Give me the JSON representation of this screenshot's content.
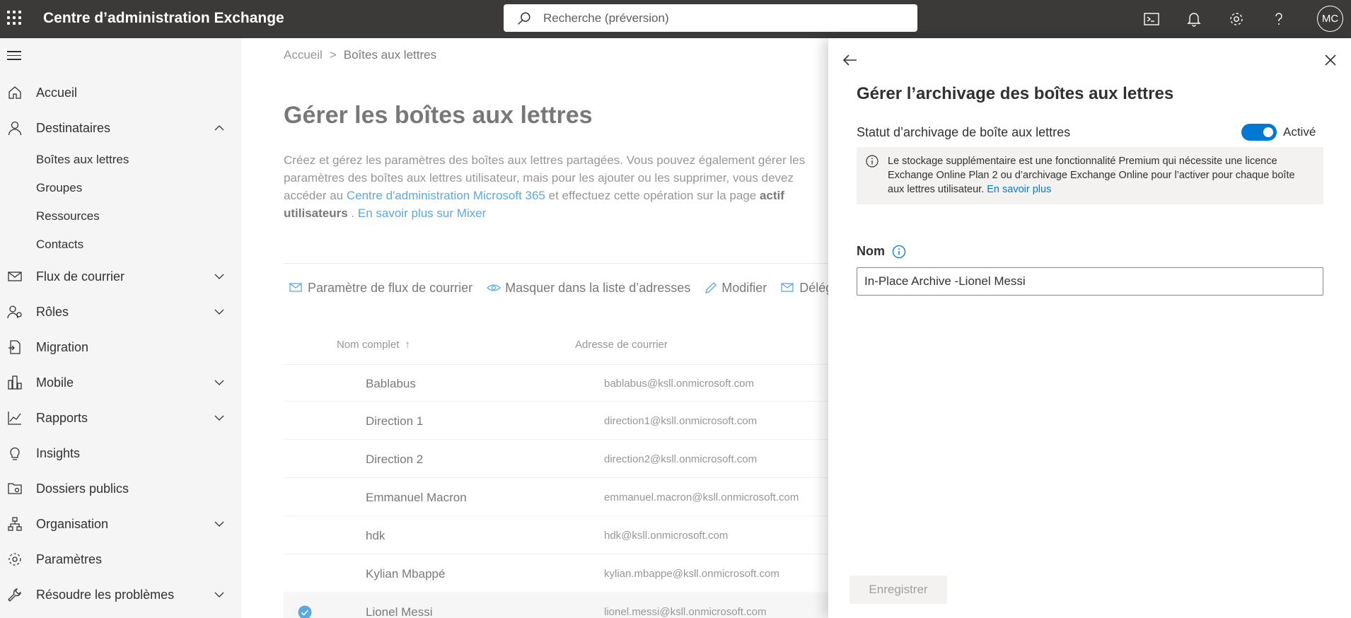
{
  "header": {
    "app_title": "Centre d’administration Exchange",
    "search_placeholder": "Recherche (préversion)",
    "icons": [
      "terminal-icon",
      "bell-icon",
      "gear-icon",
      "help-icon"
    ],
    "avatar_initials": "MC"
  },
  "sidebar": {
    "items": [
      {
        "label": "Accueil",
        "icon": "home-icon"
      },
      {
        "label": "Destinataires",
        "icon": "person-icon",
        "expanded": true
      },
      {
        "label": "Flux de courrier",
        "icon": "mail-icon"
      },
      {
        "label": "Rôles",
        "icon": "roles-icon"
      },
      {
        "label": "Migration",
        "icon": "migration-icon"
      },
      {
        "label": "Mobile",
        "icon": "mobile-icon"
      },
      {
        "label": "Rapports",
        "icon": "chart-icon"
      },
      {
        "label": "Insights",
        "icon": "lightbulb-icon"
      },
      {
        "label": "Dossiers publics",
        "icon": "folder-icon"
      },
      {
        "label": "Organisation",
        "icon": "org-icon"
      },
      {
        "label": "Paramètres",
        "icon": "gear-icon"
      },
      {
        "label": "Résoudre les problèmes",
        "icon": "wrench-icon"
      }
    ],
    "subitems": [
      "Boîtes aux lettres",
      "Groupes",
      "Ressources",
      "Contacts"
    ]
  },
  "main": {
    "breadcrumb": [
      "Accueil",
      "Boîtes aux lettres"
    ],
    "title": "Gérer les boîtes aux lettres",
    "desc_1": "Créez et gérez les paramètres des boîtes aux lettres partagées. Vous pouvez également gérer les paramètres des boîtes aux lettres utilisateur, mais pour les ajouter ou les supprimer, vous devez accéder au ",
    "desc_link_1": "Centre d'administration Microsoft 365",
    "desc_2": " et effectuez cette opération sur la page ",
    "desc_bold": "actif utilisateurs",
    "desc_3": " . ",
    "desc_link_2": "En savoir plus sur Mixer",
    "toolbar": [
      "Paramètre de flux de courrier",
      "Masquer dans la liste d’adresses",
      "Modifier",
      "Délég"
    ],
    "columns": {
      "name": "Nom complet",
      "sort_arrow": "↑",
      "email": "Adresse de courrier"
    },
    "rows": [
      {
        "name": "Bablabus",
        "email": "bablabus@ksll.onmicrosoft.com"
      },
      {
        "name": "Direction 1",
        "email": "direction1@ksll.onmicrosoft.com"
      },
      {
        "name": "Direction 2",
        "email": "direction2@ksll.onmicrosoft.com"
      },
      {
        "name": "Emmanuel Macron",
        "email": "emmanuel.macron@ksll.onmicrosoft.com"
      },
      {
        "name": "hdk",
        "email": "hdk@ksll.onmicrosoft.com"
      },
      {
        "name": "Kylian Mbappé",
        "email": "kylian.mbappe@ksll.onmicrosoft.com"
      },
      {
        "name": "Lionel Messi",
        "email": "lionel.messi@ksll.onmicrosoft.com",
        "selected": true
      }
    ]
  },
  "panel": {
    "title": "Gérer l’archivage des boîtes aux lettres",
    "status_label": "Statut d’archivage de boîte aux lettres",
    "toggle_state": "Activé",
    "toggle_on": true,
    "info_text": "Le stockage supplémentaire est une fonctionnalité Premium qui nécessite une licence Exchange Online Plan 2 ou d’archivage Exchange Online pour l’activer pour chaque boîte aux lettres utilisateur. ",
    "info_link": "En savoir plus",
    "name_label": "Nom",
    "name_value": "In-Place Archive -Lionel Messi",
    "save_label": "Enregistrer"
  },
  "colors": {
    "topbar": "#3b3a39",
    "accent": "#0078d4",
    "sidebar_bg": "#f5f5f5"
  }
}
